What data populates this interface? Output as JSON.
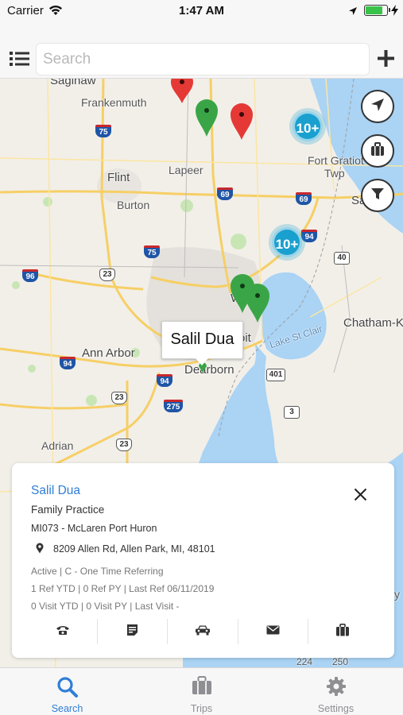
{
  "status_bar": {
    "carrier": "Carrier",
    "time": "1:47 AM",
    "battery_level": 0.85
  },
  "search": {
    "placeholder": "Search",
    "value": ""
  },
  "icons": {
    "menu": "list-icon",
    "add": "plus-icon",
    "locate": "location-arrow-icon",
    "trips": "briefcase-icon",
    "filter": "filter-icon",
    "close": "close-icon",
    "address": "map-pin-icon",
    "call": "phone-icon",
    "note": "note-icon",
    "drive": "car-icon",
    "email": "mail-icon",
    "trip": "briefcase-icon"
  },
  "map": {
    "places": [
      {
        "name": "Saginaw"
      },
      {
        "name": "Frankenmuth"
      },
      {
        "name": "Flint"
      },
      {
        "name": "Burton"
      },
      {
        "name": "Lapeer"
      },
      {
        "name": "Fort Gratiot"
      },
      {
        "name": "Twp"
      },
      {
        "name": "Sa"
      },
      {
        "name": "Ann Arbor"
      },
      {
        "name": "Dearborn"
      },
      {
        "name": "Wa"
      },
      {
        "name": "oit"
      },
      {
        "name": "Chatham-K"
      },
      {
        "name": "Lake St Clair"
      },
      {
        "name": "Adrian"
      },
      {
        "name": "y"
      }
    ],
    "road_shields": [
      "75",
      "69",
      "69",
      "94",
      "40",
      "75",
      "96",
      "23",
      "94",
      "94",
      "401",
      "275",
      "23",
      "3",
      "23",
      "224",
      "250"
    ],
    "clusters": [
      "10+",
      "10+"
    ],
    "pin_colors": {
      "red": "#e53935",
      "green": "#3aa547"
    },
    "callout": "Salil Dua"
  },
  "card": {
    "name": "Salil Dua",
    "specialty": "Family Practice",
    "location": "MI073 - McLaren Port Huron",
    "address": "8209 Allen Rd, Allen Park, MI, 48101",
    "status": "Active | C - One Time Referring",
    "refs": "1 Ref YTD | 0 Ref PY | Last Ref 06/11/2019",
    "visits": "0 Visit YTD | 0 Visit PY | Last Visit  -"
  },
  "tabs": [
    {
      "label": "Search",
      "icon": "search-icon",
      "active": true
    },
    {
      "label": "Trips",
      "icon": "briefcase-icon",
      "active": false
    },
    {
      "label": "Settings",
      "icon": "gear-icon",
      "active": false
    }
  ],
  "colors": {
    "accent": "#2f7ed8",
    "cluster": "#1aa0cf",
    "water": "#aad3f4"
  }
}
